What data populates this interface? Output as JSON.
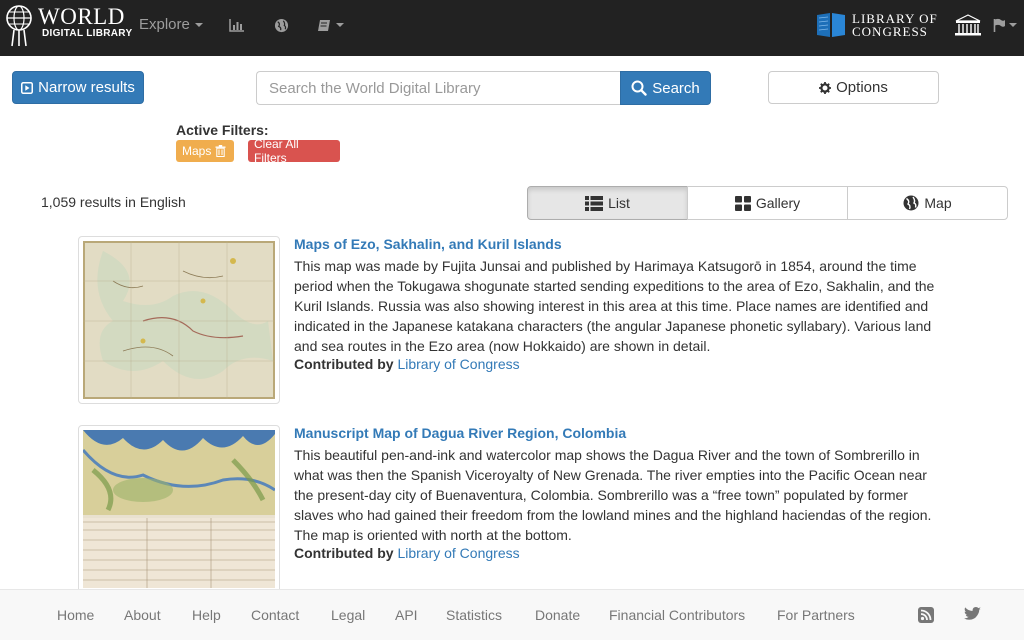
{
  "header": {
    "logo_world": "WORLD",
    "logo_subtitle": "DIGITAL LIBRARY",
    "nav": {
      "explore_label": "Explore"
    },
    "loc_line1": "LIBRARY OF",
    "loc_line2": "CONGRESS",
    "icons": [
      "globe-logo-icon",
      "bar-chart-icon",
      "globe-icon",
      "book-icon",
      "unesco-icon",
      "flag-icon"
    ]
  },
  "toolbar": {
    "narrow_label": "Narrow results",
    "search_placeholder": "Search the World Digital Library",
    "search_label": "Search",
    "options_label": "Options"
  },
  "filters": {
    "label": "Active Filters:",
    "active": "Maps",
    "clear_label": "Clear All Filters"
  },
  "results_count": "1,059 results in English",
  "views": {
    "list": "List",
    "gallery": "Gallery",
    "map": "Map"
  },
  "results": [
    {
      "title": "Maps of Ezo, Sakhalin, and Kuril Islands",
      "description": "This map was made by Fujita Junsai and published by Harimaya Katsugorō in 1854, around the time period when the Tokugawa shogunate started sending expeditions to the area of Ezo, Sakhalin, and the Kuril Islands. Russia was also showing interest in this area at this time. Place names are identified and indicated in the Japanese katakana characters (the angular Japanese phonetic syllabary). Various land and sea routes in the Ezo area (now Hokkaido) are shown in detail.",
      "contributed_label": "Contributed by",
      "contributor": "Library of Congress"
    },
    {
      "title": "Manuscript Map of Dagua River Region, Colombia",
      "description": "This beautiful pen-and-ink and watercolor map shows the Dagua River and the town of Sombrerillo in what was then the Spanish Viceroyalty of New Grenada. The river empties into the Pacific Ocean near the present-day city of Buenaventura, Colombia. Sombrerillo was a “free town” populated by former slaves who had gained their freedom from the lowland mines and the highland haciendas of the region. The map is oriented with north at the bottom.",
      "contributed_label": "Contributed by",
      "contributor": "Library of Congress"
    }
  ],
  "footer": {
    "links": [
      "Home",
      "About",
      "Help",
      "Contact",
      "Legal",
      "API",
      "Statistics",
      "Donate",
      "Financial Contributors",
      "For Partners"
    ]
  },
  "colors": {
    "primary": "#337ab7",
    "warning": "#f0ad4e",
    "danger": "#d9534f",
    "navbar": "#222222"
  }
}
